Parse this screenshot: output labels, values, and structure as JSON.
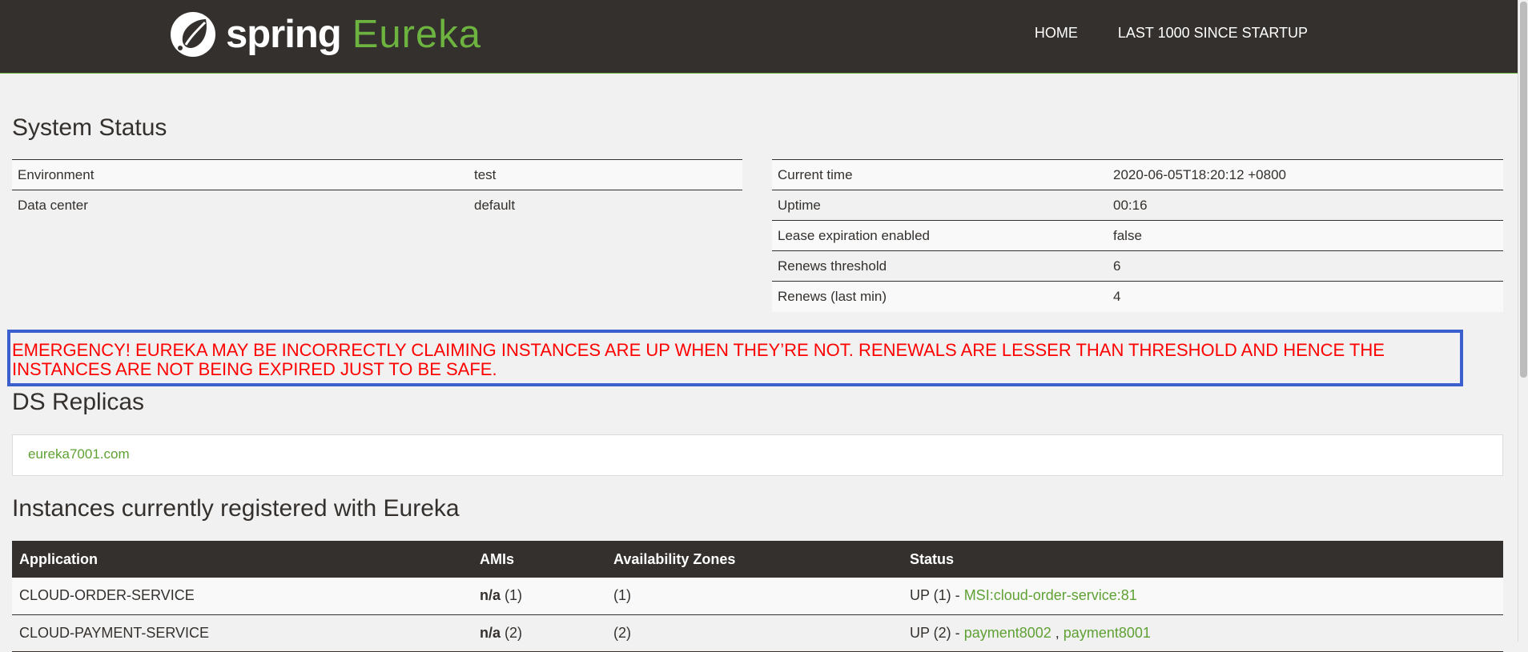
{
  "header": {
    "logo_spring": "spring",
    "logo_eureka": "Eureka",
    "nav": {
      "home": "HOME",
      "last1000": "LAST 1000 SINCE STARTUP"
    }
  },
  "system_status": {
    "title": "System Status",
    "left": [
      {
        "label": "Environment",
        "value": "test"
      },
      {
        "label": "Data center",
        "value": "default"
      }
    ],
    "right": [
      {
        "label": "Current time",
        "value": "2020-06-05T18:20:12 +0800"
      },
      {
        "label": "Uptime",
        "value": "00:16"
      },
      {
        "label": "Lease expiration enabled",
        "value": "false"
      },
      {
        "label": "Renews threshold",
        "value": "6"
      },
      {
        "label": "Renews (last min)",
        "value": "4"
      }
    ]
  },
  "emergency": {
    "line1": "EMERGENCY! EUREKA MAY BE INCORRECTLY CLAIMING INSTANCES ARE UP WHEN THEY’RE NOT. RENEWALS ARE LESSER THAN THRESHOLD AND HENCE THE",
    "line2": "INSTANCES ARE NOT BEING EXPIRED JUST TO BE SAFE."
  },
  "replicas": {
    "title": "DS Replicas",
    "link": "eureka7001.com"
  },
  "instances": {
    "title": "Instances currently registered with Eureka",
    "headers": {
      "application": "Application",
      "amis": "AMIs",
      "zones": "Availability Zones",
      "status": "Status"
    },
    "rows": [
      {
        "application": "CLOUD-ORDER-SERVICE",
        "ami_na": "n/a",
        "ami_count": " (1)",
        "zones": "(1)",
        "status_prefix": "UP (1) - ",
        "link1": "MSI:cloud-order-service:81",
        "separator": "",
        "link2": ""
      },
      {
        "application": "CLOUD-PAYMENT-SERVICE",
        "ami_na": "n/a",
        "ami_count": " (2)",
        "zones": "(2)",
        "status_prefix": "UP (2) - ",
        "link1": "payment8002",
        "separator": " , ",
        "link2": "payment8001"
      }
    ]
  },
  "colors": {
    "header_bg": "#34302d",
    "brand_green": "#6db33f",
    "emergency_red": "#ff0000",
    "highlight_border": "#3b5fcd"
  },
  "icons": [
    "spring-leaf-icon"
  ]
}
